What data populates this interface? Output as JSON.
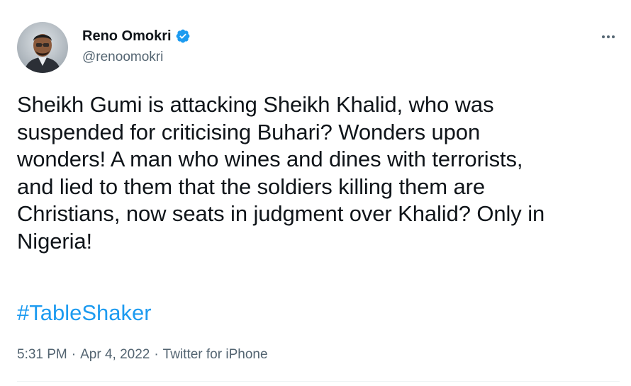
{
  "tweet": {
    "author": {
      "display_name": "Reno Omokri",
      "handle": "@renoomokri",
      "verified": true
    },
    "text": "Sheikh Gumi is attacking Sheikh Khalid, who was suspended for criticising Buhari? Wonders upon wonders! A man who wines and dines with terrorists, and lied to them that the soldiers killing them are Christians, now seats in judgment over Khalid? Only in Nigeria!",
    "text_lines": [
      "Sheikh Gumi is attacking Sheikh Khalid, who was",
      "suspended for criticising Buhari? Wonders upon",
      "wonders! A man who wines and dines with terrorists,",
      "and lied to them that the soldiers killing them are",
      "Christians, now seats in judgment over Khalid? Only in",
      "Nigeria!"
    ],
    "hashtag": "#TableShaker",
    "time": "5:31 PM",
    "date": "Apr 4, 2022",
    "source": "Twitter for iPhone",
    "separator": "·"
  },
  "icons": {
    "verified": "verified-badge-icon",
    "more": "more-options-icon"
  },
  "colors": {
    "text": "#0f1419",
    "secondary": "#536471",
    "link": "#1d9bf0",
    "divider": "#eff3f4"
  }
}
